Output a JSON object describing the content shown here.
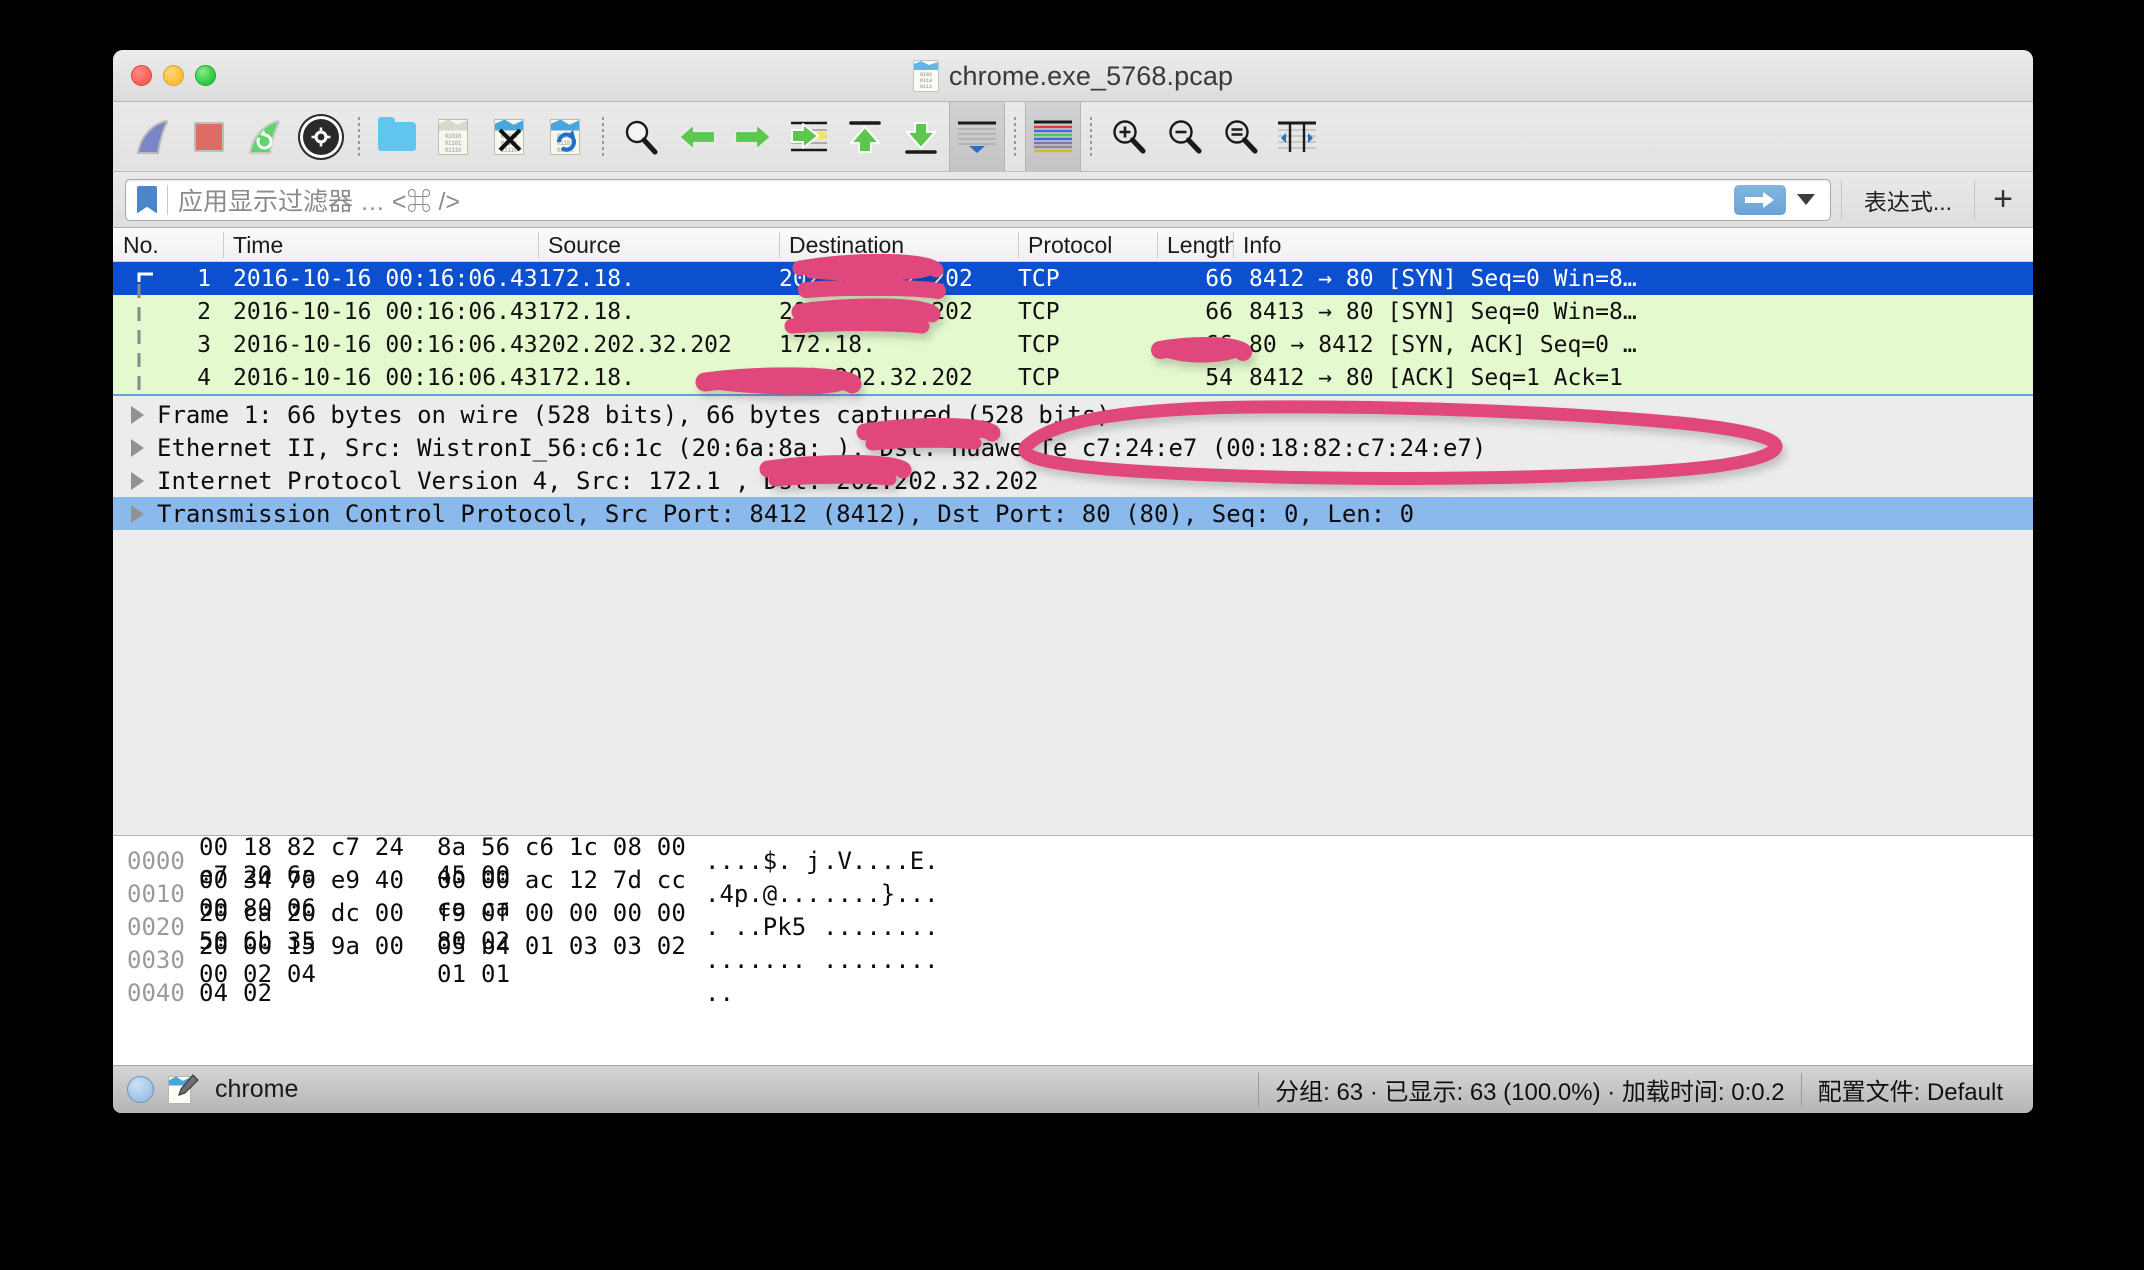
{
  "window": {
    "title": "chrome.exe_5768.pcap",
    "doc_icon_bits": "0101\n0110\n0111",
    "traffic_lights": [
      "close",
      "minimize",
      "maximize"
    ]
  },
  "toolbar": {
    "items": [
      {
        "name": "start-capture",
        "icon": "blue-shark-fin"
      },
      {
        "name": "stop-capture",
        "icon": "red-square"
      },
      {
        "name": "restart-capture",
        "icon": "green-shark-fin-refresh"
      },
      {
        "name": "capture-options",
        "icon": "gear"
      },
      {
        "name": "open-file",
        "icon": "blue-folder"
      },
      {
        "name": "save-file",
        "icon": "binary-document"
      },
      {
        "name": "close-file",
        "icon": "document-x"
      },
      {
        "name": "reload-file",
        "icon": "document-refresh"
      },
      {
        "name": "find-packet",
        "icon": "magnifier"
      },
      {
        "name": "go-back",
        "icon": "green-left-arrow"
      },
      {
        "name": "go-forward",
        "icon": "green-right-arrow"
      },
      {
        "name": "go-to-packet",
        "icon": "green-arrow-into-lines"
      },
      {
        "name": "go-to-first-packet",
        "icon": "green-up-arrow-bar"
      },
      {
        "name": "go-to-last-packet",
        "icon": "green-down-arrow-bar"
      },
      {
        "name": "auto-scroll-live",
        "icon": "lines-with-blue-marker"
      },
      {
        "name": "colorize-packets",
        "icon": "colored-lines"
      },
      {
        "name": "zoom-in",
        "icon": "magnifier-plus"
      },
      {
        "name": "zoom-out",
        "icon": "magnifier-minus"
      },
      {
        "name": "zoom-reset",
        "icon": "magnifier-equals"
      },
      {
        "name": "resize-columns",
        "icon": "columns-resize"
      }
    ]
  },
  "filter": {
    "placeholder": "应用显示过滤器 … <⌘ />",
    "value": "",
    "apply_label": "",
    "expression_label": "表达式...",
    "plus_label": "+"
  },
  "packet_list": {
    "columns": [
      "No.",
      "Time",
      "Source",
      "Destination",
      "Protocol",
      "Length",
      "Info"
    ],
    "rows": [
      {
        "no": "1",
        "time": "2016-10-16 00:16:06.430730",
        "source": "172.18.",
        "source_redacted": true,
        "destination": "202.202.32.202",
        "protocol": "TCP",
        "length": "66",
        "info": "8412 → 80 [SYN] Seq=0 Win=8…",
        "selected": true
      },
      {
        "no": "2",
        "time": "2016-10-16 00:16:06.431018",
        "source": "172.18.",
        "source_redacted": true,
        "destination": "202.202.32.202",
        "protocol": "TCP",
        "length": "66",
        "info": "8413 → 80 [SYN] Seq=0 Win=8…",
        "selected": false
      },
      {
        "no": "3",
        "time": "2016-10-16 00:16:06.431144",
        "source": "202.202.32.202",
        "source_redacted": false,
        "destination": "172.18.",
        "destination_redacted": true,
        "protocol": "TCP",
        "length": "66",
        "info": "80 → 8412 [SYN, ACK] Seq=0 …",
        "selected": false
      },
      {
        "no": "4",
        "time": "2016-10-16 00:16:06.431197",
        "source": "172.18.",
        "source_redacted": true,
        "destination": "202.202.32.202",
        "protocol": "TCP",
        "length": "54",
        "info": "8412 → 80 [ACK] Seq=1 Ack=1",
        "selected": false,
        "clipped": true
      }
    ]
  },
  "packet_details": {
    "rows": [
      {
        "label": "Frame 1: 66 bytes on wire (528 bits), 66 bytes captured (528 bits)",
        "selected": false
      },
      {
        "label": "Ethernet II, Src: WistronI_56:c6:1c (20:6a:8a:          ), Dst: HuaweiTe c7:24:e7 (00:18:82:c7:24:e7)",
        "selected": false
      },
      {
        "label": "Internet Protocol Version 4, Src: 172.1          , Dst: 202.202.32.202",
        "selected": false
      },
      {
        "label": "Transmission Control Protocol, Src Port: 8412 (8412), Dst Port: 80 (80), Seq: 0, Len: 0",
        "selected": true
      }
    ]
  },
  "hex_dump": {
    "rows": [
      {
        "offset": "0000",
        "bytes1": "00 18 82 c7 24 e7 20 6a",
        "bytes2": "8a 56 c6 1c 08 00 45 00",
        "ascii1": "....$. j",
        "ascii2": ".V....E."
      },
      {
        "offset": "0010",
        "bytes1": "00 34 70 e9 40 00 80 06",
        "bytes2": "00 00 ac 12 7d cc ca ca",
        "ascii1": ".4p.@...",
        "ascii2": "....}..."
      },
      {
        "offset": "0020",
        "bytes1": "20 ca 20 dc 00 50 6b 35",
        "bytes2": "f9 0f 00 00 00 00 80 02",
        "ascii1": ". ..Pk5",
        "ascii2": "........"
      },
      {
        "offset": "0030",
        "bytes1": "20 00 15 9a 00 00 02 04",
        "bytes2": "05 b4 01 03 03 02 01 01",
        "ascii1": "....... ",
        "ascii2": "........"
      },
      {
        "offset": "0040",
        "bytes1": "04 02",
        "bytes2": "",
        "ascii1": "..",
        "ascii2": ""
      }
    ]
  },
  "status_bar": {
    "capture_name": "chrome",
    "stats": "分组: 63 · 已显示: 63 (100.0%) · 加载时间: 0:0.2",
    "profile": "配置文件: Default"
  },
  "annotation": {
    "color": "#e0467c",
    "marks": [
      {
        "name": "redaction-source-row1",
        "type": "scribble"
      },
      {
        "name": "redaction-source-row2",
        "type": "scribble"
      },
      {
        "name": "redaction-destination-row3",
        "type": "scribble"
      },
      {
        "name": "redaction-source-row4",
        "type": "scribble"
      },
      {
        "name": "redaction-ethernet-src-mac",
        "type": "scribble"
      },
      {
        "name": "redaction-ip-src",
        "type": "scribble"
      },
      {
        "name": "highlight-ethernet-dst-mac",
        "type": "ellipse"
      }
    ]
  }
}
